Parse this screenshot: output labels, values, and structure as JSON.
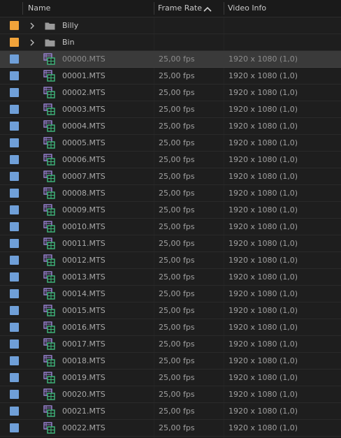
{
  "colors": {
    "folder_label": "#f1a33a",
    "clip_label": "#6f9fd8",
    "clip_icon_purple": "#9b84d6",
    "clip_icon_green": "#3fb97d"
  },
  "header": {
    "name": "Name",
    "frame_rate": "Frame Rate",
    "video_info": "Video Info",
    "sort_icon": "chevron-up-icon"
  },
  "folders": [
    {
      "name": "Billy",
      "icon": "folder-icon",
      "expand_icon": "chevron-right-icon"
    },
    {
      "name": "Bin",
      "icon": "folder-icon",
      "expand_icon": "chevron-right-icon"
    }
  ],
  "clips": [
    {
      "name": "00000.MTS",
      "frame_rate": "25,00 fps",
      "video_info": "1920 x 1080 (1,0)",
      "selected": true
    },
    {
      "name": "00001.MTS",
      "frame_rate": "25,00 fps",
      "video_info": "1920 x 1080 (1,0)"
    },
    {
      "name": "00002.MTS",
      "frame_rate": "25,00 fps",
      "video_info": "1920 x 1080 (1,0)"
    },
    {
      "name": "00003.MTS",
      "frame_rate": "25,00 fps",
      "video_info": "1920 x 1080 (1,0)"
    },
    {
      "name": "00004.MTS",
      "frame_rate": "25,00 fps",
      "video_info": "1920 x 1080 (1,0)"
    },
    {
      "name": "00005.MTS",
      "frame_rate": "25,00 fps",
      "video_info": "1920 x 1080 (1,0)"
    },
    {
      "name": "00006.MTS",
      "frame_rate": "25,00 fps",
      "video_info": "1920 x 1080 (1,0)"
    },
    {
      "name": "00007.MTS",
      "frame_rate": "25,00 fps",
      "video_info": "1920 x 1080 (1,0)"
    },
    {
      "name": "00008.MTS",
      "frame_rate": "25,00 fps",
      "video_info": "1920 x 1080 (1,0)"
    },
    {
      "name": "00009.MTS",
      "frame_rate": "25,00 fps",
      "video_info": "1920 x 1080 (1,0)"
    },
    {
      "name": "00010.MTS",
      "frame_rate": "25,00 fps",
      "video_info": "1920 x 1080 (1,0)"
    },
    {
      "name": "00011.MTS",
      "frame_rate": "25,00 fps",
      "video_info": "1920 x 1080 (1,0)"
    },
    {
      "name": "00012.MTS",
      "frame_rate": "25,00 fps",
      "video_info": "1920 x 1080 (1,0)"
    },
    {
      "name": "00013.MTS",
      "frame_rate": "25,00 fps",
      "video_info": "1920 x 1080 (1,0)"
    },
    {
      "name": "00014.MTS",
      "frame_rate": "25,00 fps",
      "video_info": "1920 x 1080 (1,0)"
    },
    {
      "name": "00015.MTS",
      "frame_rate": "25,00 fps",
      "video_info": "1920 x 1080 (1,0)"
    },
    {
      "name": "00016.MTS",
      "frame_rate": "25,00 fps",
      "video_info": "1920 x 1080 (1,0)"
    },
    {
      "name": "00017.MTS",
      "frame_rate": "25,00 fps",
      "video_info": "1920 x 1080 (1,0)"
    },
    {
      "name": "00018.MTS",
      "frame_rate": "25,00 fps",
      "video_info": "1920 x 1080 (1,0)"
    },
    {
      "name": "00019.MTS",
      "frame_rate": "25,00 fps",
      "video_info": "1920 x 1080 (1,0)"
    },
    {
      "name": "00020.MTS",
      "frame_rate": "25,00 fps",
      "video_info": "1920 x 1080 (1,0)"
    },
    {
      "name": "00021.MTS",
      "frame_rate": "25,00 fps",
      "video_info": "1920 x 1080 (1,0)"
    },
    {
      "name": "00022.MTS",
      "frame_rate": "25,00 fps",
      "video_info": "1920 x 1080 (1,0)"
    }
  ]
}
